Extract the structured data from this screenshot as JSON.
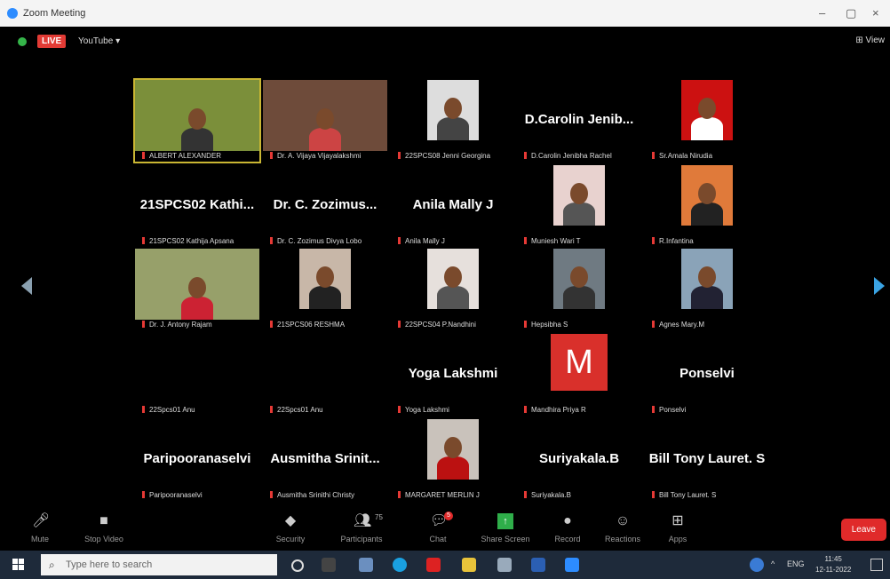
{
  "window": {
    "title": "Zoom Meeting",
    "minimize": "–",
    "maximize": "▢",
    "close": "×"
  },
  "topbar": {
    "live": "LIVE",
    "youtube": "YouTube ▾",
    "view": "⊞ View"
  },
  "tiles": [
    {
      "caption": "ALBERT ALEXANDER",
      "type": "video"
    },
    {
      "caption": "Dr. A. Vijaya Vijayalakshmi",
      "type": "video"
    },
    {
      "caption": "22SPCS08 Jenni Georgina",
      "type": "video"
    },
    {
      "caption": "D.Carolin Jenibha Rachel",
      "display": "D.Carolin Jenib...",
      "type": "name"
    },
    {
      "caption": "Sr.Amala Nirudia",
      "type": "video"
    },
    {
      "caption": "21SPCS02 Kathija Apsana",
      "display": "21SPCS02 Kathi...",
      "type": "name"
    },
    {
      "caption": "Dr. C. Zozimus Divya Lobo",
      "display": "Dr. C. Zozimus...",
      "type": "name"
    },
    {
      "caption": "Anila Mally J",
      "display": "Anila Mally J",
      "type": "name"
    },
    {
      "caption": "Muniesh Wari T",
      "type": "video"
    },
    {
      "caption": "R.Infantina",
      "type": "video"
    },
    {
      "caption": "Dr. J. Antony Rajam",
      "type": "video"
    },
    {
      "caption": "21SPCS06 RESHMA",
      "type": "video"
    },
    {
      "caption": "22SPCS04 P.Nandhini",
      "type": "video"
    },
    {
      "caption": "Hepsibha S",
      "type": "video"
    },
    {
      "caption": "Agnes Mary.M",
      "type": "video"
    },
    {
      "caption": "22Spcs01 Anu",
      "display": "",
      "type": "name"
    },
    {
      "caption": "22Spcs01 Anu",
      "display": "",
      "type": "name"
    },
    {
      "caption": "Yoga Lakshmi",
      "display": "Yoga Lakshmi",
      "type": "name"
    },
    {
      "caption": "Mandhira Priya R",
      "avatar": "M",
      "type": "avatar"
    },
    {
      "caption": "Ponselvi",
      "display": "Ponselvi",
      "type": "name"
    },
    {
      "caption": "Paripooranaselvi",
      "display": "Paripooranaselvi",
      "type": "name"
    },
    {
      "caption": "Ausmitha Srinithi Christy",
      "display": "Ausmitha Srinit...",
      "type": "name"
    },
    {
      "caption": "MARGARET MERLIN J",
      "type": "video"
    },
    {
      "caption": "Suriyakala.B",
      "display": "Suriyakala.B",
      "type": "name"
    },
    {
      "caption": "Bill Tony Lauret. S",
      "display": "Bill Tony Lauret. S",
      "type": "name"
    }
  ],
  "toolbar": {
    "mute": "Mute",
    "stop_video": "Stop Video",
    "security": "Security",
    "participants": "Participants",
    "participants_count": "75",
    "chat": "Chat",
    "chat_badge": "5",
    "share_screen": "Share Screen",
    "record": "Record",
    "reactions": "Reactions",
    "apps": "Apps",
    "leave": "Leave"
  },
  "taskbar": {
    "search_placeholder": "Type here to search",
    "lang": "ENG",
    "time": "11:45",
    "date": "12-11-2022"
  },
  "colors": {
    "leave": "#e02a2a",
    "live": "#e23b35",
    "accent": "#2d8cff"
  }
}
